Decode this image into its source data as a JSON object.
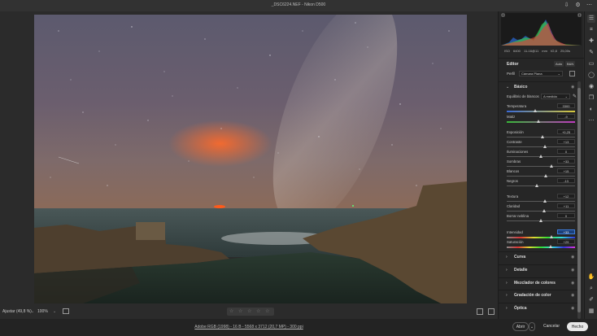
{
  "window": {
    "title": "_DSC6224.NEF  -  Nikon D500"
  },
  "titlebar_icons": [
    "export-icon",
    "gear-icon",
    "more-icon"
  ],
  "bottom_bar": {
    "zoom_fit": "Ajustar (49,8 %)",
    "zoom_pct": "100%",
    "rating_stars": "☆ ☆ ☆ ☆ ☆"
  },
  "footer": {
    "info": "Adobe RGB (1998) - 16 B - 5568 x 3712 (20,7 MP) - 300 ppi",
    "open_label": "Abrir",
    "cancel_label": "Cancelar",
    "done_label": "Hecho"
  },
  "camera_info": {
    "iso": "ISO 6400",
    "lens": "11-16@11 mm",
    "aperture": "f/2,8",
    "shutter": "25,00s"
  },
  "editor": {
    "title": "Editor",
    "auto_label": "Auto",
    "bw_label": "B&N",
    "profile_label": "Perfil",
    "profile_value": "Cámara Plana"
  },
  "basic": {
    "section_label": "Básico",
    "wb_label": "Equilibrio de blancos",
    "wb_value": "A medida",
    "sliders": [
      {
        "label": "Temperatura",
        "value": "3300",
        "pos": 0.42
      },
      {
        "label": "Matiz",
        "value": "-9",
        "pos": 0.47
      },
      {
        "label": "Exposición",
        "value": "+0,25",
        "pos": 0.52
      },
      {
        "label": "Contraste",
        "value": "+13",
        "pos": 0.56
      },
      {
        "label": "Iluminaciones",
        "value": "0",
        "pos": 0.5
      },
      {
        "label": "Sombras",
        "value": "+33",
        "pos": 0.66
      },
      {
        "label": "Blancos",
        "value": "+15",
        "pos": 0.57
      },
      {
        "label": "Negros",
        "value": "-13",
        "pos": 0.44
      },
      {
        "label": "Textura",
        "value": "+12",
        "pos": 0.56
      },
      {
        "label": "Claridad",
        "value": "+11",
        "pos": 0.55
      },
      {
        "label": "Borrar neblina",
        "value": "0",
        "pos": 0.5
      },
      {
        "label": "Intensidad",
        "value": "+33",
        "pos": 0.66,
        "active": true
      },
      {
        "label": "Saturación",
        "value": "+29",
        "pos": 0.64
      }
    ]
  },
  "sections": [
    {
      "label": "Curva"
    },
    {
      "label": "Detalle"
    },
    {
      "label": "Mezclador de colores"
    },
    {
      "label": "Gradación de color"
    },
    {
      "label": "Óptica"
    }
  ],
  "tools": [
    "edit-sliders-icon",
    "crop-icon",
    "healing-brush-icon",
    "adjustment-brush-icon",
    "graduated-filter-icon",
    "radial-filter-icon",
    "red-eye-icon",
    "snapshots-icon",
    "presets-icon",
    "more-dots-icon"
  ],
  "bottom_tools": [
    "hand-icon",
    "zoom-icon",
    "color-sampler-icon",
    "grid-view-icon"
  ],
  "colors": {
    "accent": "#3d7bd9",
    "panel_bg": "#262626",
    "app_bg": "#2b2b2b"
  }
}
